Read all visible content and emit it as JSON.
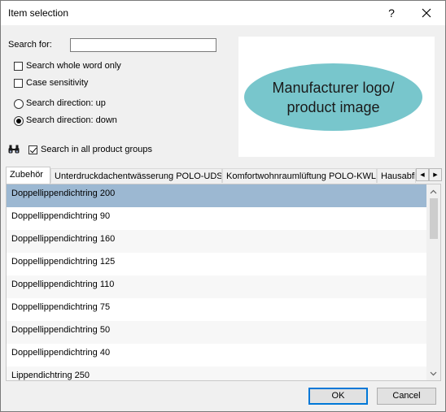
{
  "window": {
    "title": "Item selection",
    "help_glyph": "?",
    "close_glyph": "✕"
  },
  "search": {
    "label": "Search for:",
    "value": "",
    "placeholder": ""
  },
  "options": {
    "whole_word": {
      "label": "Search whole word only",
      "checked": false
    },
    "case_sensitivity": {
      "label": "Case sensitivity",
      "checked": false
    },
    "direction_up": {
      "label": "Search direction: up",
      "selected": false
    },
    "direction_down": {
      "label": "Search direction: down",
      "selected": true
    },
    "all_groups": {
      "label": "Search in all product groups",
      "checked": true
    }
  },
  "logo": {
    "text": "Manufacturer logo/ product image",
    "color": "#78c6cc"
  },
  "tabs": [
    {
      "label": "Zubehör",
      "active": true
    },
    {
      "label": "Unterdruckdachentwässerung POLO-UDS",
      "active": false
    },
    {
      "label": "Komfortwohnraumlüftung POLO-KWL",
      "active": false
    },
    {
      "label": "Hausabflu",
      "active": false
    }
  ],
  "list": {
    "items": [
      {
        "label": "Doppellippendichtring 200",
        "selected": true
      },
      {
        "label": "Doppellippendichtring 90",
        "selected": false
      },
      {
        "label": "Doppellippendichtring 160",
        "selected": false
      },
      {
        "label": "Doppellippendichtring 125",
        "selected": false
      },
      {
        "label": "Doppellippendichtring 110",
        "selected": false
      },
      {
        "label": "Doppellippendichtring 75",
        "selected": false
      },
      {
        "label": "Doppellippendichtring 50",
        "selected": false
      },
      {
        "label": "Doppellippendichtring 40",
        "selected": false
      },
      {
        "label": "Lippendichtring 250",
        "selected": false
      }
    ],
    "selected_color": "#9cb8d2"
  },
  "buttons": {
    "ok": "OK",
    "cancel": "Cancel"
  }
}
